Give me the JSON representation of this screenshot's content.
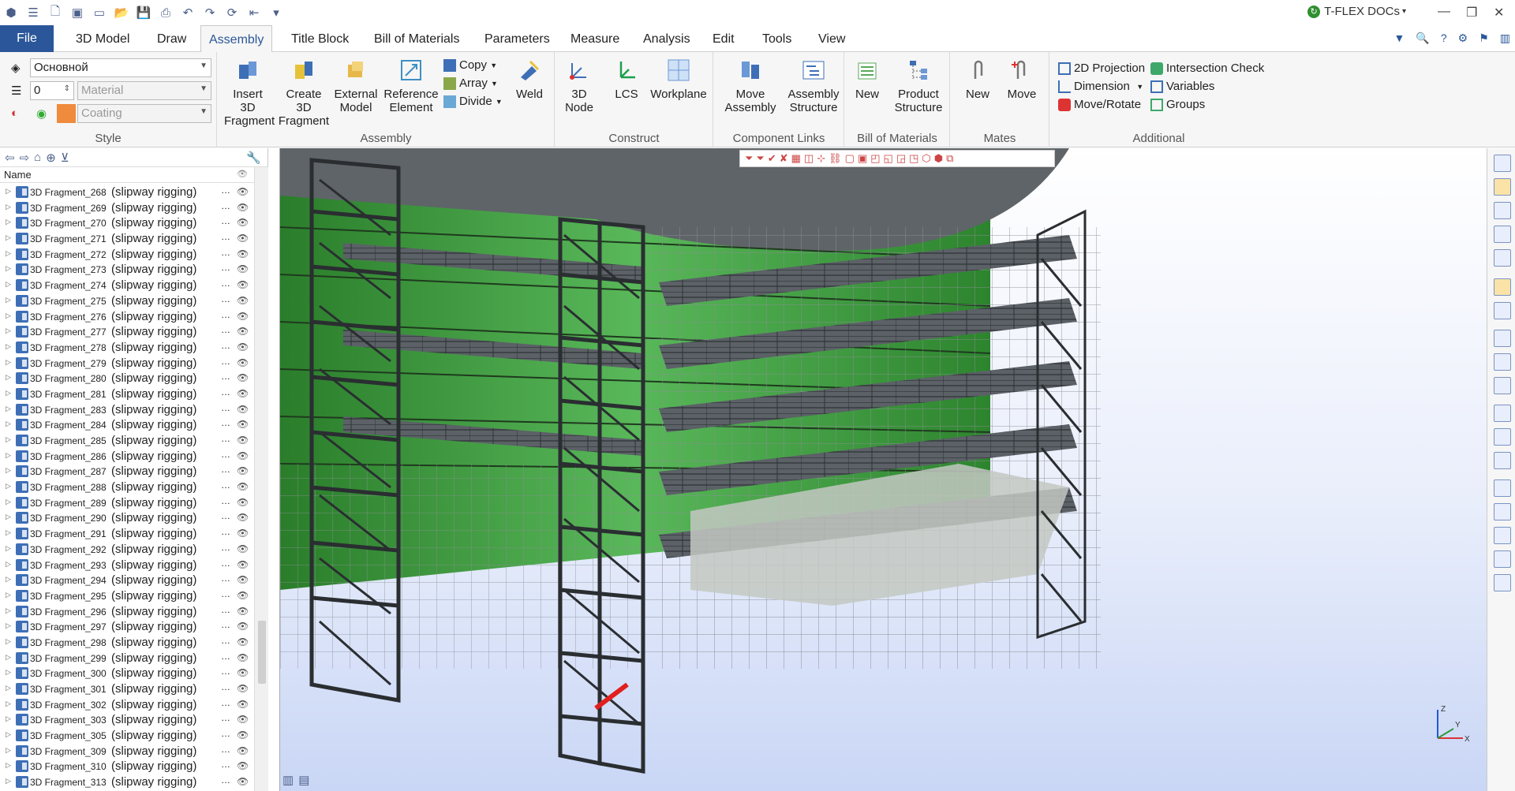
{
  "app": {
    "brand": "T-FLEX DOCs"
  },
  "tabs": [
    "3D Model",
    "Draw",
    "Assembly",
    "Title Block",
    "Bill of Materials",
    "Parameters",
    "Measure",
    "Analysis",
    "Edit",
    "Tools",
    "View"
  ],
  "active_tab": "Assembly",
  "file_tab": "File",
  "style": {
    "layer": "Основной",
    "level": "0",
    "material_placeholder": "Material",
    "coating_placeholder": "Coating",
    "label": "Style",
    "swatch_color": "#f08a3c"
  },
  "assembly": {
    "insert": "Insert 3D Fragment",
    "create": "Create 3D Fragment",
    "external": "External Model",
    "reference": "Reference Element",
    "copy": "Copy",
    "array": "Array",
    "divide": "Divide",
    "weld": "Weld",
    "label": "Assembly"
  },
  "construct": {
    "node": "3D Node",
    "lcs": "LCS",
    "workplane": "Workplane",
    "label": "Construct"
  },
  "component_links": {
    "move_assembly": "Move Assembly",
    "assembly_structure": "Assembly Structure",
    "label": "Component Links"
  },
  "bom": {
    "new": "New",
    "product_structure": "Product Structure",
    "label": "Bill of Materials"
  },
  "mates": {
    "new": "New",
    "move": "Move",
    "label": "Mates"
  },
  "additional": {
    "projection": "2D Projection",
    "dimension": "Dimension",
    "move_rotate": "Move/Rotate",
    "intersection": "Intersection Check",
    "variables": "Variables",
    "groups": "Groups",
    "label": "Additional"
  },
  "panel": {
    "column_name": "Name",
    "rows": [
      {
        "name": "3D Fragment_268",
        "desc": "(slipway rigging)"
      },
      {
        "name": "3D Fragment_269",
        "desc": "(slipway rigging)"
      },
      {
        "name": "3D Fragment_270",
        "desc": "(slipway rigging)"
      },
      {
        "name": "3D Fragment_271",
        "desc": "(slipway rigging)"
      },
      {
        "name": "3D Fragment_272",
        "desc": "(slipway rigging)"
      },
      {
        "name": "3D Fragment_273",
        "desc": "(slipway rigging)"
      },
      {
        "name": "3D Fragment_274",
        "desc": "(slipway rigging)"
      },
      {
        "name": "3D Fragment_275",
        "desc": "(slipway rigging)"
      },
      {
        "name": "3D Fragment_276",
        "desc": "(slipway rigging)"
      },
      {
        "name": "3D Fragment_277",
        "desc": "(slipway rigging)"
      },
      {
        "name": "3D Fragment_278",
        "desc": "(slipway rigging)"
      },
      {
        "name": "3D Fragment_279",
        "desc": "(slipway rigging)"
      },
      {
        "name": "3D Fragment_280",
        "desc": "(slipway rigging)"
      },
      {
        "name": "3D Fragment_281",
        "desc": "(slipway rigging)"
      },
      {
        "name": "3D Fragment_283",
        "desc": "(slipway rigging)"
      },
      {
        "name": "3D Fragment_284",
        "desc": "(slipway rigging)"
      },
      {
        "name": "3D Fragment_285",
        "desc": "(slipway rigging)"
      },
      {
        "name": "3D Fragment_286",
        "desc": "(slipway rigging)"
      },
      {
        "name": "3D Fragment_287",
        "desc": "(slipway rigging)"
      },
      {
        "name": "3D Fragment_288",
        "desc": "(slipway rigging)"
      },
      {
        "name": "3D Fragment_289",
        "desc": "(slipway rigging)"
      },
      {
        "name": "3D Fragment_290",
        "desc": "(slipway rigging)"
      },
      {
        "name": "3D Fragment_291",
        "desc": "(slipway rigging)"
      },
      {
        "name": "3D Fragment_292",
        "desc": "(slipway rigging)"
      },
      {
        "name": "3D Fragment_293",
        "desc": "(slipway rigging)"
      },
      {
        "name": "3D Fragment_294",
        "desc": "(slipway rigging)"
      },
      {
        "name": "3D Fragment_295",
        "desc": "(slipway rigging)"
      },
      {
        "name": "3D Fragment_296",
        "desc": "(slipway rigging)"
      },
      {
        "name": "3D Fragment_297",
        "desc": "(slipway rigging)"
      },
      {
        "name": "3D Fragment_298",
        "desc": "(slipway rigging)"
      },
      {
        "name": "3D Fragment_299",
        "desc": "(slipway rigging)"
      },
      {
        "name": "3D Fragment_300",
        "desc": "(slipway rigging)"
      },
      {
        "name": "3D Fragment_301",
        "desc": "(slipway rigging)"
      },
      {
        "name": "3D Fragment_302",
        "desc": "(slipway rigging)"
      },
      {
        "name": "3D Fragment_303",
        "desc": "(slipway rigging)"
      },
      {
        "name": "3D Fragment_305",
        "desc": "(slipway rigging)"
      },
      {
        "name": "3D Fragment_309",
        "desc": "(slipway rigging)"
      },
      {
        "name": "3D Fragment_310",
        "desc": "(slipway rigging)"
      },
      {
        "name": "3D Fragment_313",
        "desc": "(slipway rigging)"
      }
    ]
  },
  "colors": {
    "accent": "#2b579a",
    "hull_green": "#3c9a3c",
    "deck_gray": "#555b60"
  }
}
